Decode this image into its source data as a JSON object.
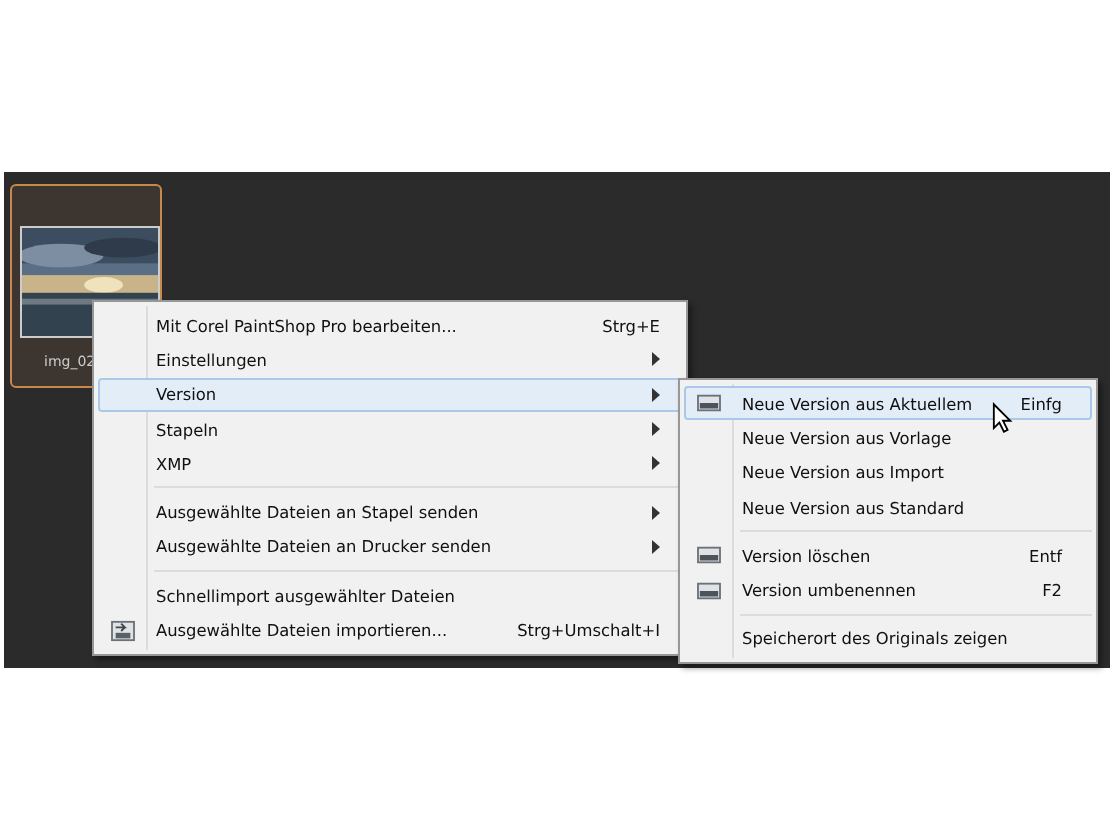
{
  "thumbnail": {
    "caption": "img_02",
    "selected": true
  },
  "context_menu": {
    "groups": [
      [
        {
          "label": "Mit Corel PaintShop Pro bearbeiten...",
          "shortcut": "Strg+E",
          "submenu": false,
          "selected": false,
          "icon": false
        },
        {
          "label": "Einstellungen",
          "submenu": true,
          "selected": false,
          "icon": false
        },
        {
          "label": "Version",
          "submenu": true,
          "selected": true,
          "icon": false
        },
        {
          "label": "Stapeln",
          "submenu": true,
          "selected": false,
          "icon": false
        },
        {
          "label": "XMP",
          "submenu": true,
          "selected": false,
          "icon": false
        }
      ],
      [
        {
          "label": "Ausgewählte Dateien an Stapel senden",
          "submenu": true,
          "selected": false,
          "icon": false
        },
        {
          "label": "Ausgewählte Dateien an Drucker senden",
          "submenu": true,
          "selected": false,
          "icon": false
        }
      ],
      [
        {
          "label": "Schnellimport ausgewählter Dateien",
          "submenu": false,
          "selected": false,
          "icon": false
        },
        {
          "label": "Ausgewählte Dateien importieren...",
          "shortcut": "Strg+Umschalt+I",
          "submenu": false,
          "selected": false,
          "icon": true
        }
      ]
    ]
  },
  "submenu": {
    "groups": [
      [
        {
          "label": "Neue Version aus Aktuellem",
          "shortcut": "Einfg",
          "selected": true,
          "icon": true
        },
        {
          "label": "Neue Version aus Vorlage",
          "selected": false,
          "icon": false
        },
        {
          "label": "Neue Version aus Import",
          "selected": false,
          "icon": false
        },
        {
          "label": "Neue Version aus Standard",
          "selected": false,
          "icon": false
        }
      ],
      [
        {
          "label": "Version löschen",
          "shortcut": "Entf",
          "selected": false,
          "icon": true
        },
        {
          "label": "Version umbenennen",
          "shortcut": "F2",
          "selected": false,
          "icon": true
        }
      ],
      [
        {
          "label": "Speicherort des Originals zeigen",
          "selected": false,
          "icon": false
        }
      ]
    ]
  }
}
